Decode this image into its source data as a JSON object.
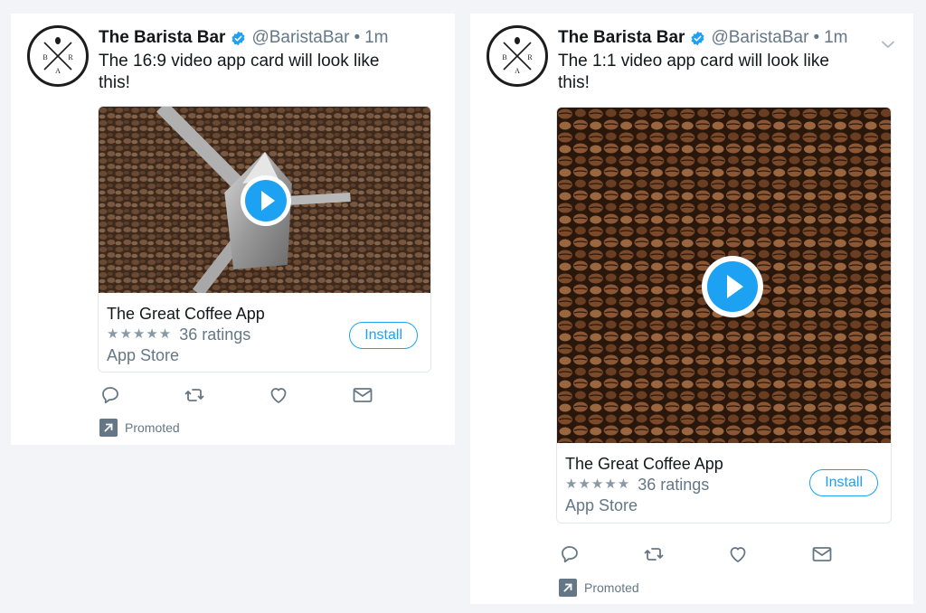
{
  "tweets": [
    {
      "author_name": "The Barista Bar",
      "handle": "@BaristaBar",
      "separator": "•",
      "time": "1m",
      "avatar_letters": [
        "B",
        "R",
        "A"
      ],
      "text": "The 16:9 video app card will look like this!",
      "card": {
        "app_name": "The Great Coffee App",
        "stars": "★★★★★",
        "rating": 4.5,
        "ratings_count": "36 ratings",
        "store": "App Store",
        "install_label": "Install"
      },
      "promoted_label": "Promoted"
    },
    {
      "author_name": "The Barista Bar",
      "handle": "@BaristaBar",
      "separator": "•",
      "time": "1m",
      "avatar_letters": [
        "B",
        "R",
        "A"
      ],
      "text": "The 1:1 video app card will look like this!",
      "card": {
        "app_name": "The Great Coffee App",
        "stars": "★★★★★",
        "rating": 4.5,
        "ratings_count": "36 ratings",
        "store": "App Store",
        "install_label": "Install"
      },
      "promoted_label": "Promoted"
    }
  ],
  "colors": {
    "accent": "#1da1f2",
    "secondary_text": "#657786",
    "card_border": "#e1e8ed",
    "background": "#f2f4f7"
  },
  "icons": [
    "verified-icon",
    "play-icon",
    "reply-icon",
    "retweet-icon",
    "like-icon",
    "dm-icon",
    "promoted-icon",
    "caret-down-icon"
  ]
}
